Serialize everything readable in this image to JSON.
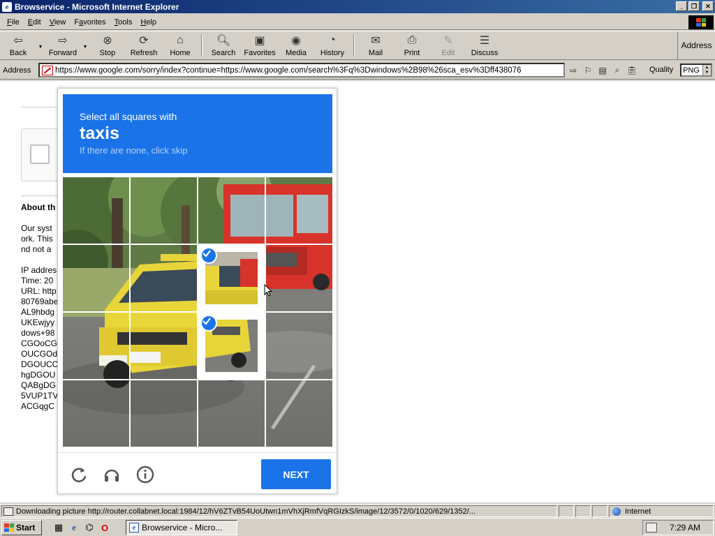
{
  "window": {
    "title": "Browservice - Microsoft Internet Explorer"
  },
  "menu": [
    {
      "key": "F",
      "rest": "ile"
    },
    {
      "key": "E",
      "rest": "dit"
    },
    {
      "key": "V",
      "rest": "iew"
    },
    {
      "key": "F",
      "rest": "avorites",
      "pre": ""
    },
    {
      "key": "T",
      "rest": "ools"
    },
    {
      "key": "H",
      "rest": "elp"
    }
  ],
  "toolbar": {
    "back": "Back",
    "forward": "Forward",
    "stop": "Stop",
    "refresh": "Refresh",
    "home": "Home",
    "search": "Search",
    "favorites": "Favorites",
    "media": "Media",
    "history": "History",
    "mail": "Mail",
    "print": "Print",
    "edit": "Edit",
    "discuss": "Discuss",
    "address": "Address"
  },
  "addressbar": {
    "label": "Address",
    "url": "https://www.google.com/sorry/index?continue=https://www.google.com/search%3Fq%3Dwindows%2B98%26sca_esv%3Dff438076",
    "quality_label": "Quality",
    "quality_value": "PNG"
  },
  "page": {
    "about_heading": "About th",
    "lines": [
      "Our syst",
      "ork. This",
      "nd not a",
      "",
      "IP addres",
      "Time: 20",
      "URL: http",
      "80769abe",
      "AL9hbdg",
      "UKEwjyy",
      "dows+98",
      "CGOoCG",
      "OUCGOd",
      "DGOUCC",
      "hgDGOU",
      "QABgDG",
      "5VUP1TV",
      "ACGqgC"
    ]
  },
  "captcha": {
    "instruction": "Select all squares with",
    "target": "taxis",
    "hint": "If there are none, click skip",
    "next_label": "NEXT",
    "selected_tiles": [
      [
        1,
        2
      ],
      [
        2,
        2
      ]
    ],
    "colors": {
      "header": "#1a73e8",
      "taxi": "#e8d53a",
      "truck": "#d8332a"
    }
  },
  "status": {
    "text": "Downloading picture http://router.collabnet.local:1984/12/hV6ZTvB54UoUtwn1mVhXjRmfVqRGIzkS/image/12/3572/0/1020/629/1352/...",
    "zone": "Internet"
  },
  "taskbar": {
    "start": "Start",
    "task": "Browservice - Micro...",
    "clock": "7:29 AM"
  }
}
